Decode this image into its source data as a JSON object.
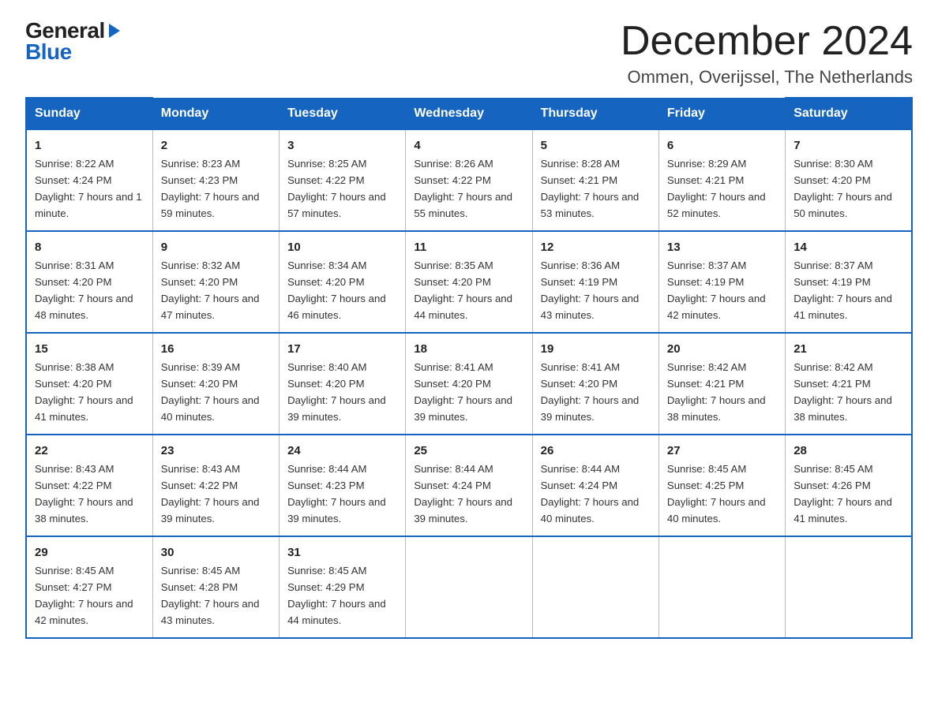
{
  "logo": {
    "text_general": "General",
    "text_blue": "Blue",
    "arrow": "▶"
  },
  "title": "December 2024",
  "location": "Ommen, Overijssel, The Netherlands",
  "days_of_week": [
    "Sunday",
    "Monday",
    "Tuesday",
    "Wednesday",
    "Thursday",
    "Friday",
    "Saturday"
  ],
  "weeks": [
    [
      {
        "day": "1",
        "sunrise": "8:22 AM",
        "sunset": "4:24 PM",
        "daylight": "7 hours and 1 minute."
      },
      {
        "day": "2",
        "sunrise": "8:23 AM",
        "sunset": "4:23 PM",
        "daylight": "7 hours and 59 minutes."
      },
      {
        "day": "3",
        "sunrise": "8:25 AM",
        "sunset": "4:22 PM",
        "daylight": "7 hours and 57 minutes."
      },
      {
        "day": "4",
        "sunrise": "8:26 AM",
        "sunset": "4:22 PM",
        "daylight": "7 hours and 55 minutes."
      },
      {
        "day": "5",
        "sunrise": "8:28 AM",
        "sunset": "4:21 PM",
        "daylight": "7 hours and 53 minutes."
      },
      {
        "day": "6",
        "sunrise": "8:29 AM",
        "sunset": "4:21 PM",
        "daylight": "7 hours and 52 minutes."
      },
      {
        "day": "7",
        "sunrise": "8:30 AM",
        "sunset": "4:20 PM",
        "daylight": "7 hours and 50 minutes."
      }
    ],
    [
      {
        "day": "8",
        "sunrise": "8:31 AM",
        "sunset": "4:20 PM",
        "daylight": "7 hours and 48 minutes."
      },
      {
        "day": "9",
        "sunrise": "8:32 AM",
        "sunset": "4:20 PM",
        "daylight": "7 hours and 47 minutes."
      },
      {
        "day": "10",
        "sunrise": "8:34 AM",
        "sunset": "4:20 PM",
        "daylight": "7 hours and 46 minutes."
      },
      {
        "day": "11",
        "sunrise": "8:35 AM",
        "sunset": "4:20 PM",
        "daylight": "7 hours and 44 minutes."
      },
      {
        "day": "12",
        "sunrise": "8:36 AM",
        "sunset": "4:19 PM",
        "daylight": "7 hours and 43 minutes."
      },
      {
        "day": "13",
        "sunrise": "8:37 AM",
        "sunset": "4:19 PM",
        "daylight": "7 hours and 42 minutes."
      },
      {
        "day": "14",
        "sunrise": "8:37 AM",
        "sunset": "4:19 PM",
        "daylight": "7 hours and 41 minutes."
      }
    ],
    [
      {
        "day": "15",
        "sunrise": "8:38 AM",
        "sunset": "4:20 PM",
        "daylight": "7 hours and 41 minutes."
      },
      {
        "day": "16",
        "sunrise": "8:39 AM",
        "sunset": "4:20 PM",
        "daylight": "7 hours and 40 minutes."
      },
      {
        "day": "17",
        "sunrise": "8:40 AM",
        "sunset": "4:20 PM",
        "daylight": "7 hours and 39 minutes."
      },
      {
        "day": "18",
        "sunrise": "8:41 AM",
        "sunset": "4:20 PM",
        "daylight": "7 hours and 39 minutes."
      },
      {
        "day": "19",
        "sunrise": "8:41 AM",
        "sunset": "4:20 PM",
        "daylight": "7 hours and 39 minutes."
      },
      {
        "day": "20",
        "sunrise": "8:42 AM",
        "sunset": "4:21 PM",
        "daylight": "7 hours and 38 minutes."
      },
      {
        "day": "21",
        "sunrise": "8:42 AM",
        "sunset": "4:21 PM",
        "daylight": "7 hours and 38 minutes."
      }
    ],
    [
      {
        "day": "22",
        "sunrise": "8:43 AM",
        "sunset": "4:22 PM",
        "daylight": "7 hours and 38 minutes."
      },
      {
        "day": "23",
        "sunrise": "8:43 AM",
        "sunset": "4:22 PM",
        "daylight": "7 hours and 39 minutes."
      },
      {
        "day": "24",
        "sunrise": "8:44 AM",
        "sunset": "4:23 PM",
        "daylight": "7 hours and 39 minutes."
      },
      {
        "day": "25",
        "sunrise": "8:44 AM",
        "sunset": "4:24 PM",
        "daylight": "7 hours and 39 minutes."
      },
      {
        "day": "26",
        "sunrise": "8:44 AM",
        "sunset": "4:24 PM",
        "daylight": "7 hours and 40 minutes."
      },
      {
        "day": "27",
        "sunrise": "8:45 AM",
        "sunset": "4:25 PM",
        "daylight": "7 hours and 40 minutes."
      },
      {
        "day": "28",
        "sunrise": "8:45 AM",
        "sunset": "4:26 PM",
        "daylight": "7 hours and 41 minutes."
      }
    ],
    [
      {
        "day": "29",
        "sunrise": "8:45 AM",
        "sunset": "4:27 PM",
        "daylight": "7 hours and 42 minutes."
      },
      {
        "day": "30",
        "sunrise": "8:45 AM",
        "sunset": "4:28 PM",
        "daylight": "7 hours and 43 minutes."
      },
      {
        "day": "31",
        "sunrise": "8:45 AM",
        "sunset": "4:29 PM",
        "daylight": "7 hours and 44 minutes."
      },
      null,
      null,
      null,
      null
    ]
  ]
}
